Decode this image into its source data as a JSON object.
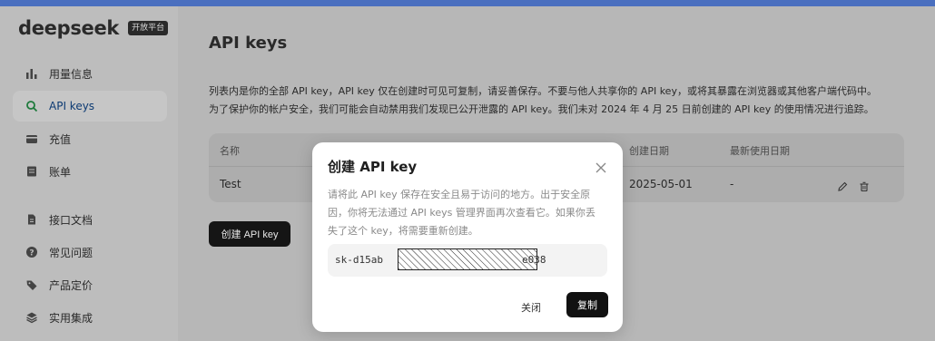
{
  "brand": {
    "logo": "deepseek",
    "badge": "开放平台"
  },
  "sidebar": {
    "items": [
      {
        "label": "用量信息",
        "icon": "bar-chart-icon"
      },
      {
        "label": "API keys",
        "icon": "search-icon"
      },
      {
        "label": "充值",
        "icon": "card-icon"
      },
      {
        "label": "账单",
        "icon": "bill-icon"
      },
      {
        "label": "接口文档",
        "icon": "document-icon"
      },
      {
        "label": "常见问题",
        "icon": "question-icon"
      },
      {
        "label": "产品定价",
        "icon": "tag-icon"
      },
      {
        "label": "实用集成",
        "icon": "stack-icon"
      }
    ],
    "active_index": 1
  },
  "main": {
    "title": "API keys",
    "desc_line1": "列表内是你的全部 API key，API key 仅在创建时可见可复制，请妥善保存。不要与他人共享你的 API key，或将其暴露在浏览器或其他客户端代码中。",
    "desc_line2": "为了保护你的帐户安全，我们可能会自动禁用我们发现已公开泄露的 API key。我们未对 2024 年 4 月 25 日前创建的 API key 的使用情况进行追踪。",
    "table": {
      "headers": [
        "名称",
        "创建日期",
        "最新使用日期"
      ],
      "rows": [
        {
          "name": "Test",
          "created": "2025-05-01",
          "last_used": "-"
        }
      ]
    },
    "create_button": "创建 API key"
  },
  "modal": {
    "title": "创建 API key",
    "text_line1": "请将此 API key 保存在安全且易于访问的地方。出于安全原",
    "text_line2": "因，你将无法通过 API keys 管理界面再次查看它。如果你丢",
    "text_line3": "失了这个 key，将需要重新创建。",
    "key_prefix": "sk-d15ab",
    "key_suffix": "e038",
    "close_label": "关闭",
    "copy_label": "复制"
  },
  "colors": {
    "accent": "#4a6fbf",
    "active_nav_text": "#0c3a73"
  }
}
